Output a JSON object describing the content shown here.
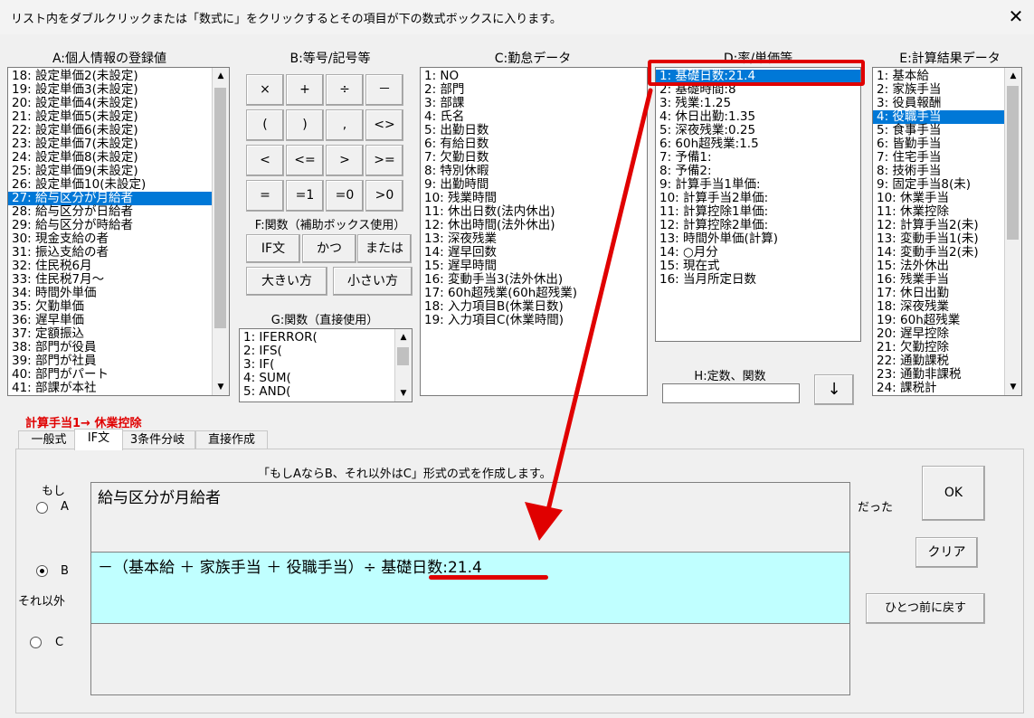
{
  "window": {
    "title": "リスト内をダブルクリックまたは「数式に」をクリックするとその項目が下の数式ボックスに入ります。",
    "close_glyph": "✕"
  },
  "sections": {
    "a": "A:個人情報の登録値",
    "b": "B:等号/記号等",
    "c": "C:勤怠データ",
    "d": "D:率/単価等",
    "e": "E:計算結果データ",
    "f": "F:関数（補助ボックス使用）",
    "g": "G:関数（直接使用）",
    "h": "H:定数、関数"
  },
  "list_a": [
    "18: 設定単価2(未設定)",
    "19: 設定単価3(未設定)",
    "20: 設定単価4(未設定)",
    "21: 設定単価5(未設定)",
    "22: 設定単価6(未設定)",
    "23: 設定単価7(未設定)",
    "24: 設定単価8(未設定)",
    "25: 設定単価9(未設定)",
    "26: 設定単価10(未設定)",
    "27: 給与区分が月給者",
    "28: 給与区分が日給者",
    "29: 給与区分が時給者",
    "30: 現金支給の者",
    "31: 振込支給の者",
    "32: 住民税6月",
    "33: 住民税7月～",
    "34: 時間外単価",
    "35: 欠勤単価",
    "36: 遅早単価",
    "37: 定額振込",
    "38: 部門が役員",
    "39: 部門が社員",
    "40: 部門がパート",
    "41: 部課が本社"
  ],
  "list_a_selected": 9,
  "ops": [
    "×",
    "+",
    "÷",
    "－",
    "(",
    ")",
    ",",
    "<>",
    "<",
    "<=",
    ">",
    ">=",
    "=",
    "=1",
    "=0",
    ">0"
  ],
  "funcs_f": [
    "IF文",
    "かつ",
    "または",
    "大きい方",
    "小さい方"
  ],
  "list_g": [
    "1: IFERROR(",
    "2: IFS(",
    "3: IF(",
    "4: SUM(",
    "5: AND("
  ],
  "list_c": [
    "1: NO",
    "2: 部門",
    "3: 部課",
    "4: 氏名",
    "5: 出勤日数",
    "6: 有給日数",
    "7: 欠勤日数",
    "8: 特別休暇",
    "9: 出勤時間",
    "10: 残業時間",
    "11: 休出日数(法内休出)",
    "12: 休出時間(法外休出)",
    "13: 深夜残業",
    "14: 遅早回数",
    "15: 遅早時間",
    "16: 変動手当3(法外休出)",
    "17: 60h超残業(60h超残業)",
    "18: 入力項目B(休業日数)",
    "19: 入力項目C(休業時間)"
  ],
  "list_d": [
    "1: 基礎日数:21.4",
    "2: 基礎時間:8",
    "3: 残業:1.25",
    "4: 休日出勤:1.35",
    "5: 深夜残業:0.25",
    "6: 60h超残業:1.5",
    "7: 予備1:",
    "8: 予備2:",
    "9: 計算手当1単価:",
    "10: 計算手当2単価:",
    "11: 計算控除1単価:",
    "12: 計算控除2単価:",
    "13: 時間外単価(計算)",
    "14: ○月分",
    "15: 現在式",
    "16: 当月所定日数"
  ],
  "list_d_selected": 0,
  "list_e": [
    "1: 基本給",
    "2: 家族手当",
    "3: 役員報酬",
    "4: 役職手当",
    "5: 食事手当",
    "6: 皆勤手当",
    "7: 住宅手当",
    "8: 技術手当",
    "9: 固定手当8(未)",
    "10: 休業手当",
    "11: 休業控除",
    "12: 計算手当2(未)",
    "13: 変動手当1(未)",
    "14: 変動手当2(未)",
    "15: 法外休出",
    "16: 残業手当",
    "17: 休日出勤",
    "18: 深夜残業",
    "19: 60h超残業",
    "20: 遅早控除",
    "21: 欠勤控除",
    "22: 通勤課税",
    "23: 通勤非課税",
    "24: 課税計"
  ],
  "list_e_selected": 3,
  "h_input_value": "",
  "h_button": "↓",
  "formula_target": "計算手当1→ 休業控除",
  "tabs": [
    "一般式",
    "IF文",
    "3条件分岐",
    "直接作成"
  ],
  "active_tab": 1,
  "ifpanel": {
    "instruction": "「もしAならB、それ以外はC」形式の式を作成します。",
    "moshi": "もし",
    "sore_igai": "それ以外",
    "datta": "だった",
    "radio_a": "A",
    "radio_b": "B",
    "radio_c": "C",
    "selected_radio": "B",
    "expr_a": "給与区分が月給者",
    "expr_b_prefix": "－（基本給 ＋ 家族手当 ＋ 役職手当）÷ ",
    "expr_b_highlight": "基礎日数:21.4",
    "expr_c": ""
  },
  "buttons": {
    "ok": "OK",
    "clear": "クリア",
    "undo": "ひとつ前に戻す"
  },
  "colors": {
    "selection": "#0078d7",
    "annotation_red": "#e00000",
    "expr_b_bg": "#c0ffff"
  }
}
